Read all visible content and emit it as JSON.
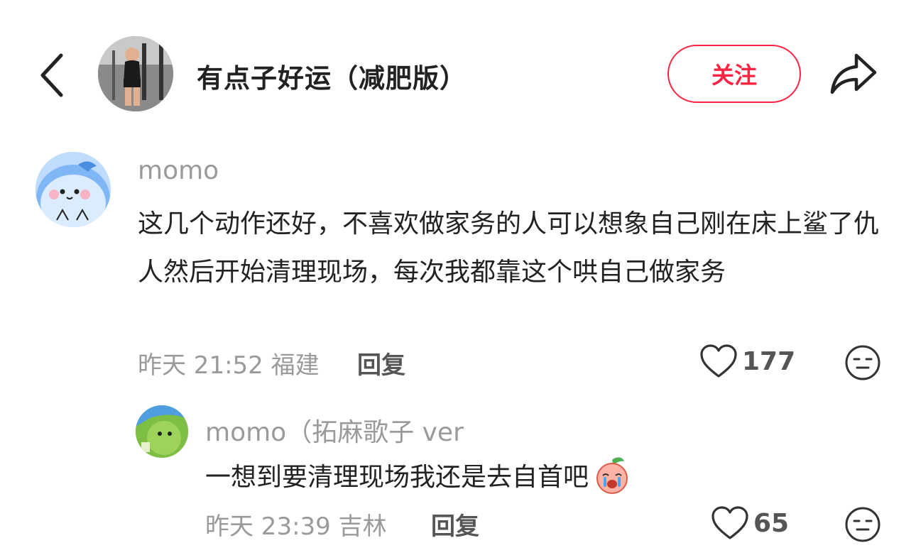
{
  "header": {
    "back_icon": "chevron-left-icon",
    "author_name": "有点子好运（减肥版）",
    "follow_label": "关注",
    "share_icon": "share-arrow-icon",
    "accent_color": "#ff2442"
  },
  "comment": {
    "username": "momo",
    "text": "这几个动作还好，不喜欢做家务的人可以想象自己刚在床上鲨了仇人然后开始清理现场，每次我都靠这个哄自己做家务",
    "time": "昨天 21:52",
    "location": "福建",
    "reply_label": "回复",
    "likes": "177",
    "like_icon": "heart-outline-icon",
    "emoji_icon": "expressionless-face-icon"
  },
  "reply": {
    "username": "momo（拓麻歌子 ver",
    "text": "一想到要清理现场我还是去自首吧",
    "sticker_icon": "crying-peach-sticker-icon",
    "time": "昨天 23:39",
    "location": "吉林",
    "reply_label": "回复",
    "likes": "65",
    "like_icon": "heart-outline-icon",
    "emoji_icon": "expressionless-face-icon"
  }
}
